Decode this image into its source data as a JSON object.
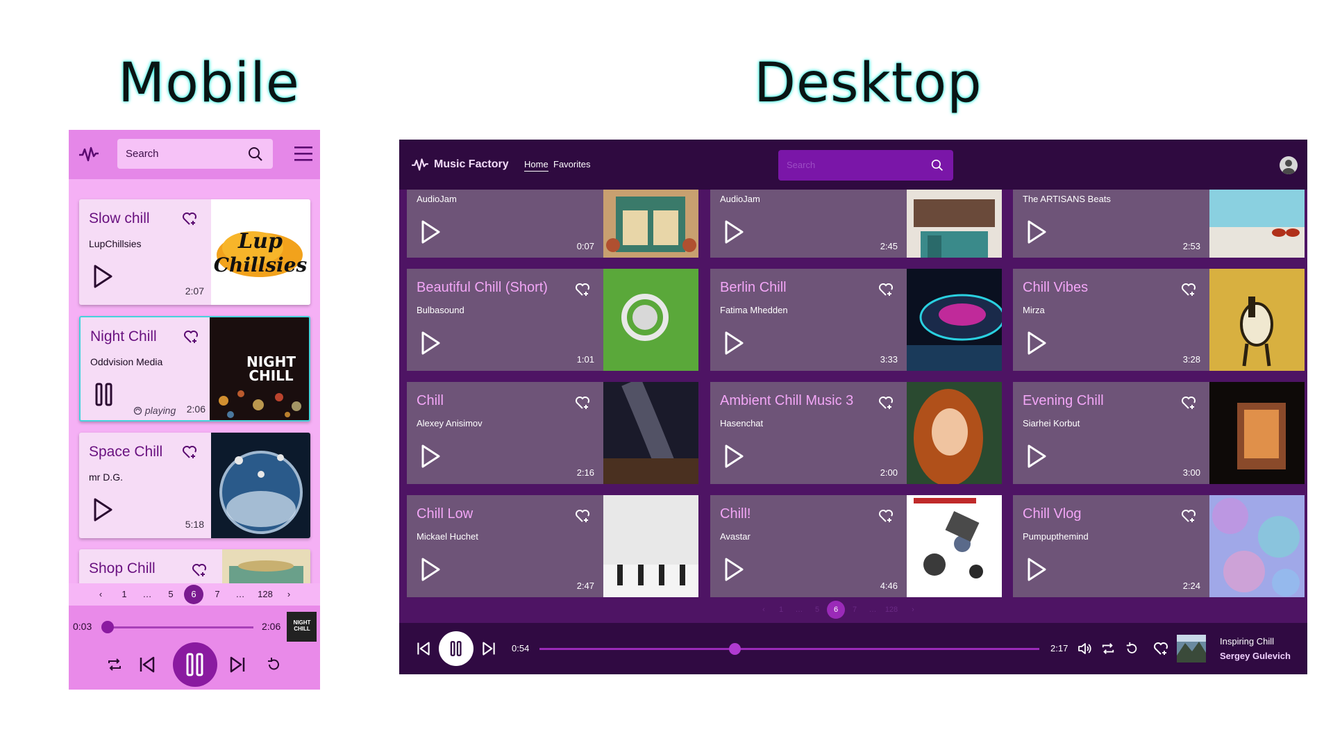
{
  "headings": {
    "mobile": "Mobile",
    "desktop": "Desktop"
  },
  "colors": {
    "accent": "#8a1aa0",
    "mobile_bg": "#f5b0f5",
    "desktop_bg": "#4e1464",
    "active_border": "#46d2dc"
  },
  "mobile": {
    "search_placeholder": "Search",
    "cards": [
      {
        "title": "Slow chill",
        "artist": "LupChillsies",
        "duration": "2:07",
        "state": "play"
      },
      {
        "title": "Night Chill",
        "artist": "Oddvision Media",
        "duration": "2:06",
        "state": "pause",
        "status": "playing",
        "art_text": "NIGHT CHILL"
      },
      {
        "title": "Space Chill",
        "artist": "mr D.G.",
        "duration": "5:18",
        "state": "play"
      },
      {
        "title": "Shop Chill",
        "artist": "",
        "duration": "",
        "state": "play"
      }
    ],
    "pager": {
      "prev": "‹",
      "pages": [
        "1",
        "…",
        "5",
        "6",
        "7",
        "…",
        "128"
      ],
      "next": "›",
      "current": "6"
    },
    "player": {
      "elapsed": "0:03",
      "total": "2:06",
      "progress": 0.02,
      "cover_text": "NIGHT CHILL"
    }
  },
  "desktop": {
    "brand": "Music Factory",
    "nav": {
      "home": "Home",
      "favorites": "Favorites"
    },
    "search_placeholder": "Search",
    "top_row": [
      {
        "artist": "AudioJam",
        "duration": "0:07"
      },
      {
        "artist": "AudioJam",
        "duration": "2:45"
      },
      {
        "artist": "The ARTISANS Beats",
        "duration": "2:53"
      }
    ],
    "cards": [
      {
        "title": "Beautiful Chill (Short)",
        "artist": "Bulbasound",
        "duration": "1:01"
      },
      {
        "title": "Berlin Chill",
        "artist": "Fatima Mhedden",
        "duration": "3:33"
      },
      {
        "title": "Chill Vibes",
        "artist": "Mirza",
        "duration": "3:28"
      },
      {
        "title": "Chill",
        "artist": "Alexey Anisimov",
        "duration": "2:16"
      },
      {
        "title": "Ambient Chill Music 3",
        "artist": "Hasenchat",
        "duration": "2:00"
      },
      {
        "title": "Evening Chill",
        "artist": "Siarhei Korbut",
        "duration": "3:00"
      },
      {
        "title": "Chill Low",
        "artist": "Mickael Huchet",
        "duration": "2:47"
      },
      {
        "title": "Chill!",
        "artist": "Avastar",
        "duration": "4:46"
      },
      {
        "title": "Chill Vlog",
        "artist": "Pumpupthemind",
        "duration": "2:24"
      }
    ],
    "pager": {
      "prev": "‹",
      "pages": [
        "1",
        "…",
        "5",
        "6",
        "7",
        "…",
        "128"
      ],
      "next": "›",
      "current": "6"
    },
    "player": {
      "elapsed": "0:54",
      "total": "2:17",
      "progress": 0.39,
      "now_playing_title": "Inspiring Chill",
      "now_playing_artist": "Sergey Gulevich"
    },
    "icons": [
      "logo-pulse-icon",
      "search-icon",
      "user-avatar-icon",
      "heart-plus-icon",
      "play-icon",
      "prev-icon",
      "pause-icon",
      "next-icon",
      "volume-icon",
      "repeat-icon",
      "replay-icon"
    ]
  }
}
